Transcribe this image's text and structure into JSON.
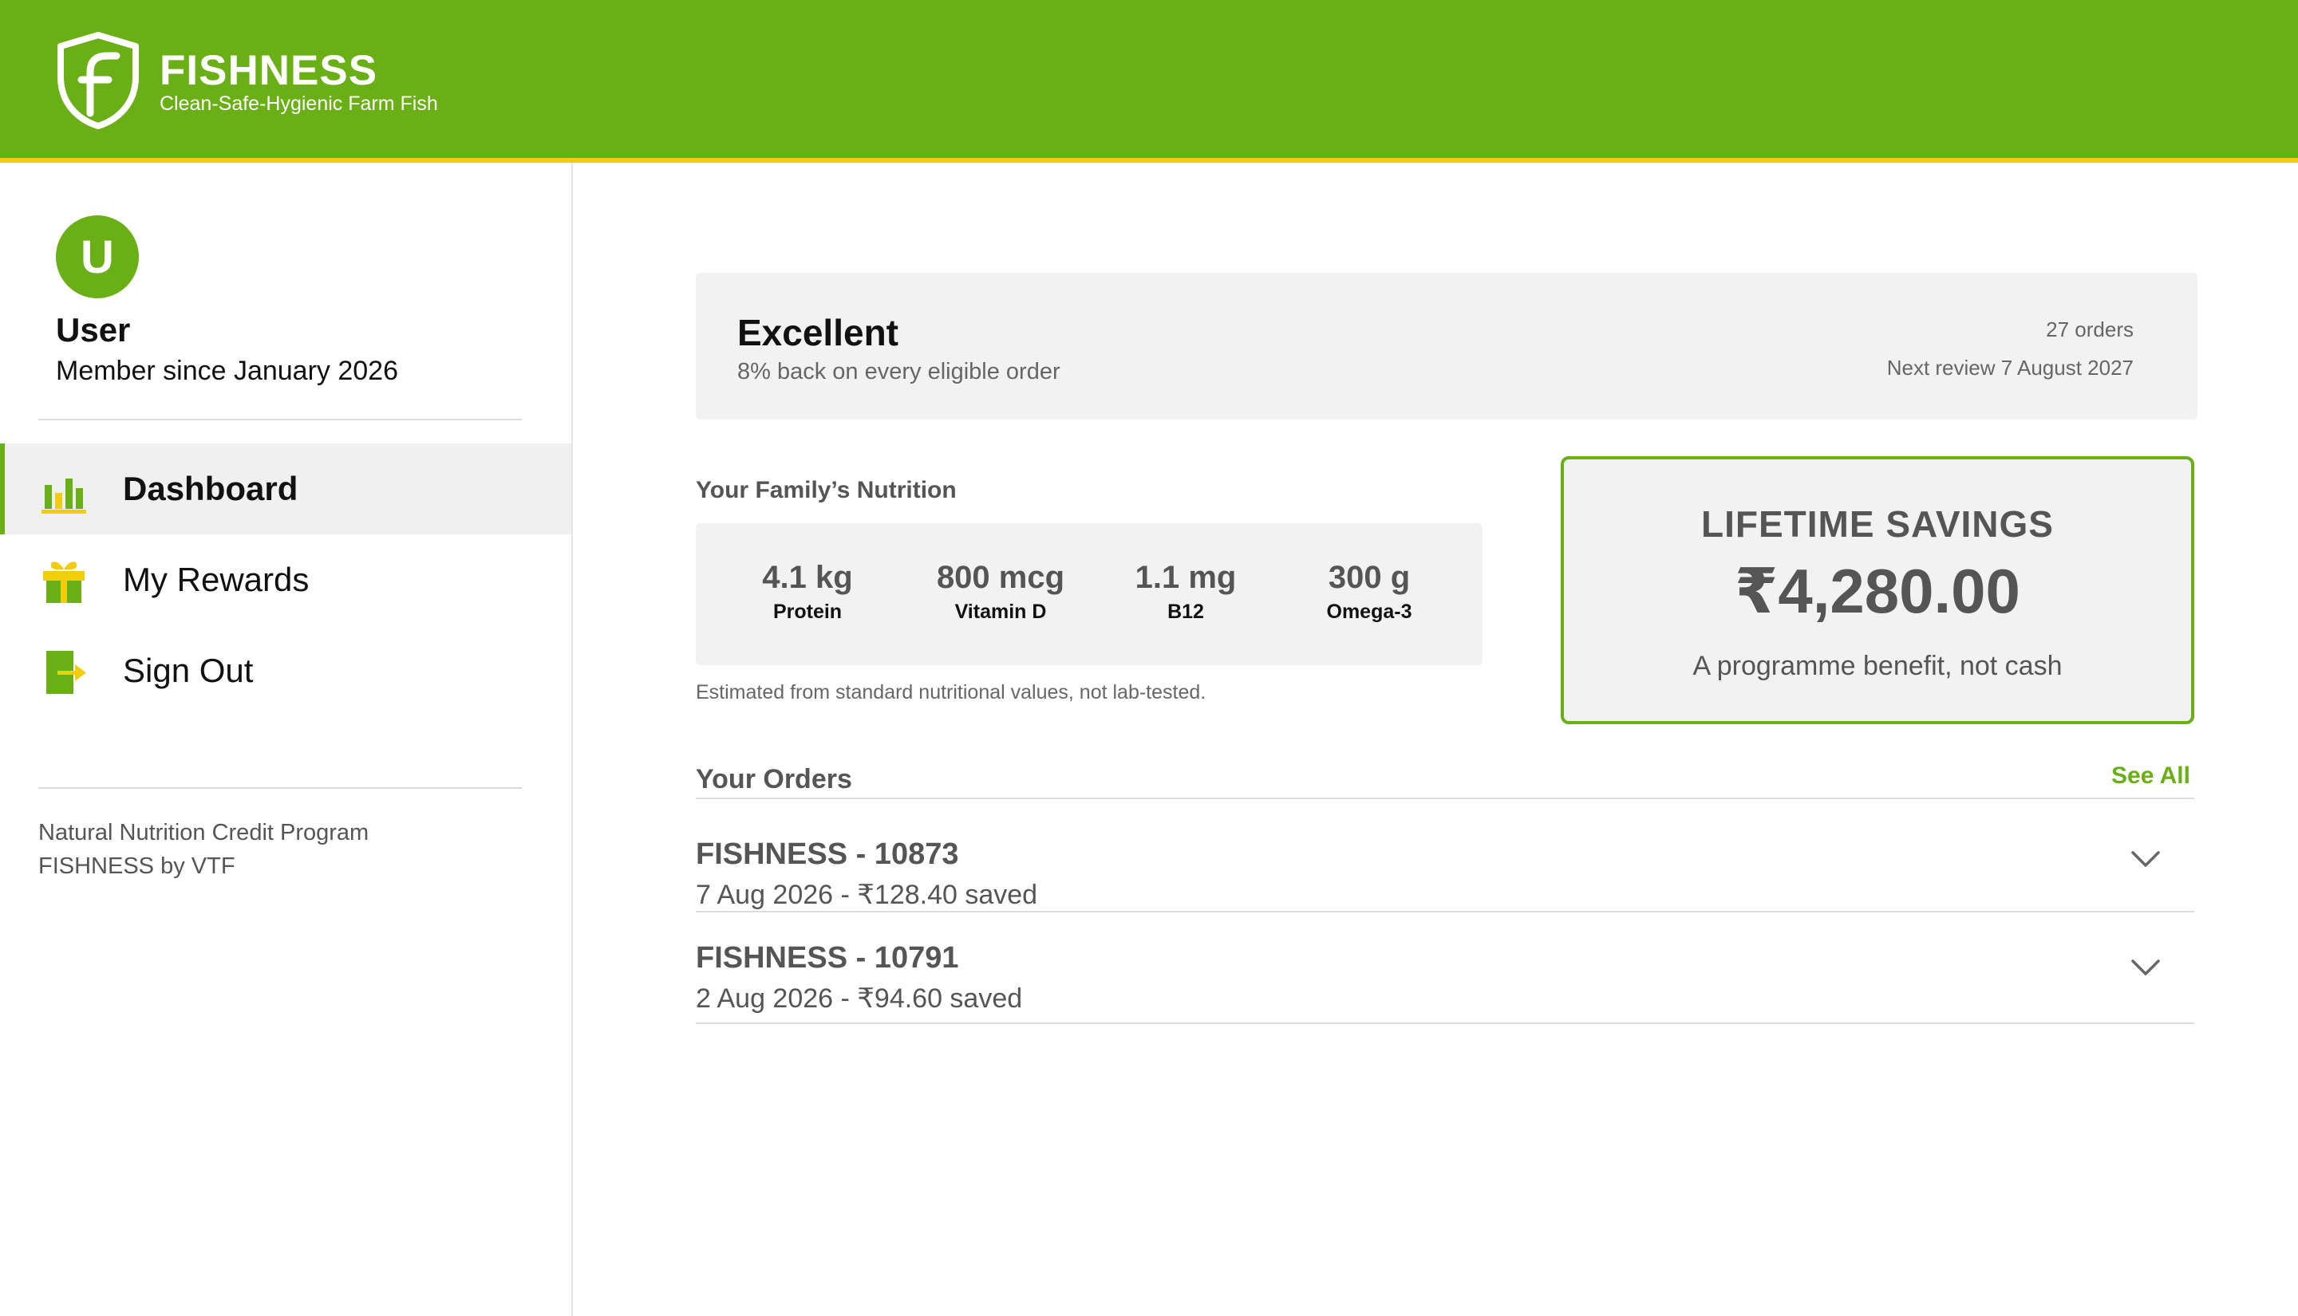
{
  "header": {
    "brand_name": "FISHNESS",
    "tagline": "Clean-Safe-Hygienic Farm Fish",
    "logo_icon": "shield-f-logo-icon",
    "bar_color": "#6aaf16",
    "accent_line_color": "#f2cd0c"
  },
  "user": {
    "avatar_initial": "U",
    "name": "User",
    "member_since": "Member since January 2026"
  },
  "nav": {
    "items": [
      {
        "label": "Dashboard",
        "icon": "bar-chart-icon",
        "active": true
      },
      {
        "label": "My Rewards",
        "icon": "gift-icon",
        "active": false
      },
      {
        "label": "Sign Out",
        "icon": "sign-out-icon",
        "active": false
      }
    ]
  },
  "sidebar_footer": {
    "program_name": "Natural Nutrition Credit Program",
    "by_line": "FISHNESS by VTF"
  },
  "tier": {
    "name": "Excellent",
    "description": "8% back on every eligible order",
    "orders_count": "27 orders",
    "next_review": "Next review 7 August 2027"
  },
  "nutrition": {
    "title": "Your Family’s Nutrition",
    "items": [
      {
        "value": "4.1 kg",
        "label": "Protein"
      },
      {
        "value": "800 mcg",
        "label": "Vitamin D"
      },
      {
        "value": "1.1 mg",
        "label": "B12"
      },
      {
        "value": "300 g",
        "label": "Omega-3"
      }
    ],
    "note": "Estimated from standard nutritional values, not lab-tested."
  },
  "savings": {
    "title": "LIFETIME SAVINGS",
    "amount": "₹4,280.00",
    "note": "A programme benefit, not cash"
  },
  "orders": {
    "title": "Your Orders",
    "see_all_label": "See All",
    "items": [
      {
        "title": "FISHNESS - 10873",
        "meta": "7 Aug 2026 - ₹128.40 saved"
      },
      {
        "title": "FISHNESS - 10791",
        "meta": "2 Aug 2026 - ₹94.60 saved"
      }
    ]
  },
  "colors": {
    "brand_green": "#6aaf16",
    "brand_yellow": "#f2cd0c",
    "card_bg": "#f2f2f2"
  }
}
